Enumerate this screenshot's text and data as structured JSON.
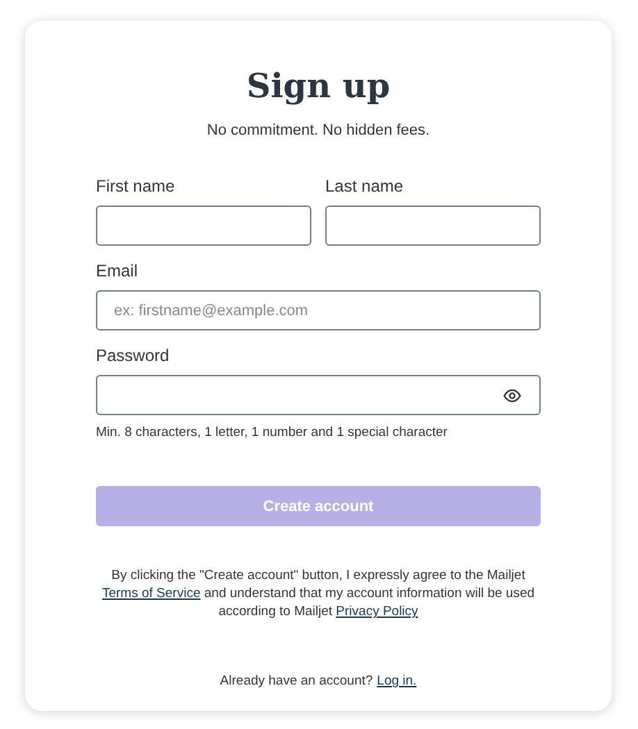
{
  "title": "Sign up",
  "subtitle": "No commitment. No hidden fees.",
  "fields": [
    {
      "label": "First name",
      "kind": "text"
    },
    {
      "label": "Last name",
      "kind": "text"
    },
    {
      "label": "Email",
      "placeholder": "ex: firstname@example.com",
      "kind": "text"
    },
    {
      "label": "Password",
      "kind": "password",
      "hint": "Min. 8 characters, 1 letter, 1 number and 1 special character"
    }
  ],
  "submit": {
    "label": "Create account",
    "disabled": true
  },
  "legal": {
    "text_before": "By clicking the \"Create account\" button, I expressly agree to the Mailjet",
    "terms_link": "Terms of Service",
    "text_middle": "and understand that my account information will be used according to Mailjet",
    "privacy_link": "Privacy Policy"
  },
  "login": {
    "text": "Already have an account?",
    "link": "Log in."
  }
}
